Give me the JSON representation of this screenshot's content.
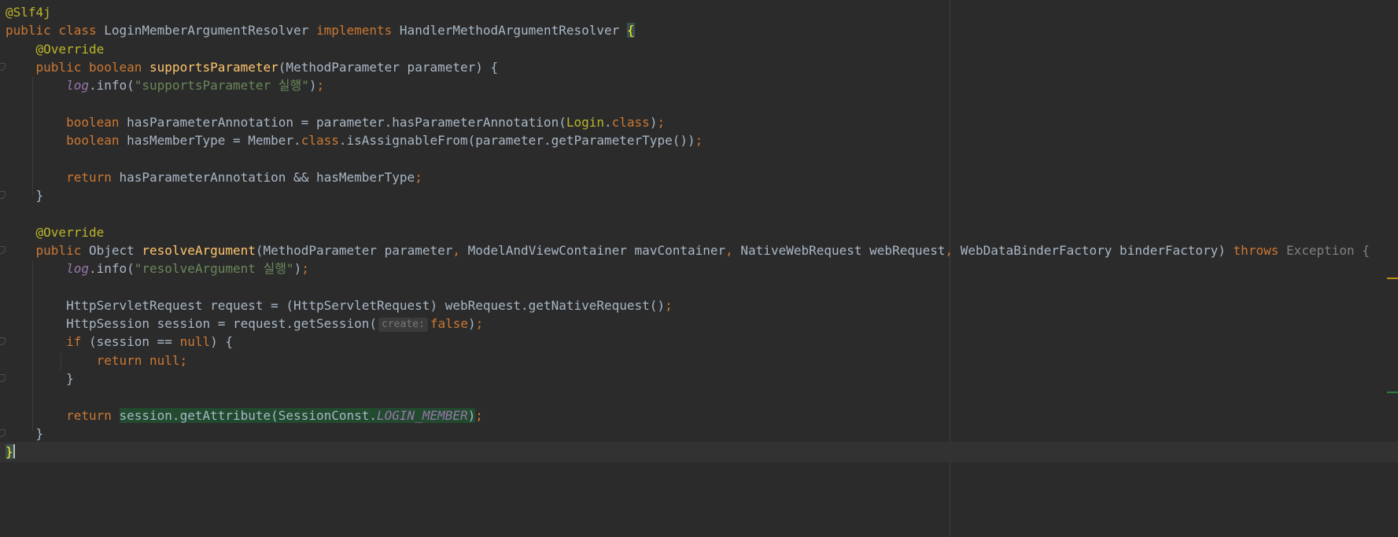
{
  "editor": {
    "lines": [
      {
        "g": "",
        "t": [
          [
            "@Slf4j",
            "t-ann"
          ]
        ]
      },
      {
        "g": "",
        "t": [
          [
            "public class ",
            "t-kw"
          ],
          [
            "LoginMemberArgumentResolver ",
            ""
          ],
          [
            "implements ",
            "t-kw"
          ],
          [
            "HandlerMethodArgumentResolver ",
            ""
          ],
          [
            "{",
            "brace-match"
          ]
        ]
      },
      {
        "g": "",
        "t": [
          [
            "    ",
            ""
          ],
          [
            "@Override",
            "t-ann"
          ]
        ]
      },
      {
        "g": "fold",
        "t": [
          [
            "    ",
            ""
          ],
          [
            "public boolean ",
            "t-kw"
          ],
          [
            "supportsParameter",
            "t-fn"
          ],
          [
            "(MethodParameter parameter) {",
            ""
          ]
        ]
      },
      {
        "g": "",
        "t": [
          [
            "        ",
            ""
          ],
          [
            "log",
            "t-field"
          ],
          [
            ".info(",
            ""
          ],
          [
            "\"supportsParameter 실행\"",
            "t-str"
          ],
          [
            ")",
            ""
          ],
          [
            ";",
            "t-kw"
          ]
        ]
      },
      {
        "g": "",
        "t": []
      },
      {
        "g": "",
        "t": [
          [
            "        ",
            ""
          ],
          [
            "boolean ",
            "t-kw"
          ],
          [
            "hasParameterAnnotation = parameter.hasParameterAnnotation(",
            ""
          ],
          [
            "Login",
            "t-ann"
          ],
          [
            ".",
            ""
          ],
          [
            "class",
            "t-kw"
          ],
          [
            ")",
            ""
          ],
          [
            ";",
            "t-kw"
          ]
        ]
      },
      {
        "g": "",
        "t": [
          [
            "        ",
            ""
          ],
          [
            "boolean ",
            "t-kw"
          ],
          [
            "hasMemberType = Member.",
            ""
          ],
          [
            "class",
            "t-kw"
          ],
          [
            ".isAssignableFrom(parameter.getParameterType())",
            ""
          ],
          [
            ";",
            "t-kw"
          ]
        ]
      },
      {
        "g": "",
        "t": []
      },
      {
        "g": "",
        "t": [
          [
            "        ",
            ""
          ],
          [
            "return ",
            "t-kw"
          ],
          [
            "hasParameterAnnotation && hasMemberType",
            ""
          ],
          [
            ";",
            "t-kw"
          ]
        ]
      },
      {
        "g": "end",
        "t": [
          [
            "    }",
            ""
          ]
        ]
      },
      {
        "g": "",
        "t": []
      },
      {
        "g": "",
        "t": [
          [
            "    ",
            ""
          ],
          [
            "@Override",
            "t-ann"
          ]
        ]
      },
      {
        "g": "fold",
        "t": [
          [
            "    ",
            ""
          ],
          [
            "public ",
            "t-kw"
          ],
          [
            "Object ",
            ""
          ],
          [
            "resolveArgument",
            "t-fn"
          ],
          [
            "(MethodParameter parameter",
            ""
          ],
          [
            ", ",
            "t-kw"
          ],
          [
            "ModelAndViewContainer mavContainer",
            ""
          ],
          [
            ", ",
            "t-kw"
          ],
          [
            "NativeWebRequest webRequest",
            ""
          ],
          [
            ", ",
            "t-kw"
          ],
          [
            "WebDataBinderFactory binderFactory) ",
            ""
          ],
          [
            "throws ",
            "t-kw"
          ],
          [
            "Exception {",
            "t-gray"
          ]
        ]
      },
      {
        "g": "",
        "t": [
          [
            "        ",
            ""
          ],
          [
            "log",
            "t-field"
          ],
          [
            ".info(",
            ""
          ],
          [
            "\"resolveArgument 실행\"",
            "t-str"
          ],
          [
            ")",
            ""
          ],
          [
            ";",
            "t-kw"
          ]
        ]
      },
      {
        "g": "",
        "t": []
      },
      {
        "g": "",
        "t": [
          [
            "        HttpServletRequest request = (HttpServletRequest) webRequest.getNativeRequest()",
            ""
          ],
          [
            ";",
            "t-kw"
          ]
        ]
      },
      {
        "g": "",
        "t": [
          [
            "        HttpSession session = request.getSession(",
            ""
          ],
          [
            "create:",
            "hint"
          ],
          [
            "false",
            "t-kw"
          ],
          [
            ")",
            ""
          ],
          [
            ";",
            "t-kw"
          ]
        ]
      },
      {
        "g": "fold",
        "t": [
          [
            "        ",
            ""
          ],
          [
            "if ",
            "t-kw"
          ],
          [
            "(session == ",
            ""
          ],
          [
            "null",
            "t-kw"
          ],
          [
            ") {",
            ""
          ]
        ]
      },
      {
        "g": "",
        "t": [
          [
            "            ",
            ""
          ],
          [
            "return null;",
            "t-kw"
          ]
        ]
      },
      {
        "g": "end",
        "t": [
          [
            "        }",
            ""
          ]
        ]
      },
      {
        "g": "",
        "t": []
      },
      {
        "g": "",
        "t": [
          [
            "        ",
            ""
          ],
          [
            "return ",
            "t-kw"
          ],
          [
            "session.getAttribute(SessionConst.",
            ""
          ],
          [
            "LOGIN_MEMBER",
            "t-static"
          ],
          [
            ")",
            ""
          ],
          [
            ";",
            "t-kw"
          ]
        ]
      },
      {
        "g": "end",
        "t": [
          [
            "    }",
            ""
          ]
        ]
      },
      {
        "g": "",
        "current": true,
        "t": [
          [
            "}",
            "brace-match"
          ]
        ]
      }
    ]
  },
  "colors": {
    "background": "#2b2b2b",
    "keyword": "#cc7832",
    "annotation": "#bbb529",
    "method": "#ffc66d",
    "string": "#6a8759",
    "field": "#9876aa",
    "text": "#a9b7c6",
    "highlight": "#214a2e"
  }
}
